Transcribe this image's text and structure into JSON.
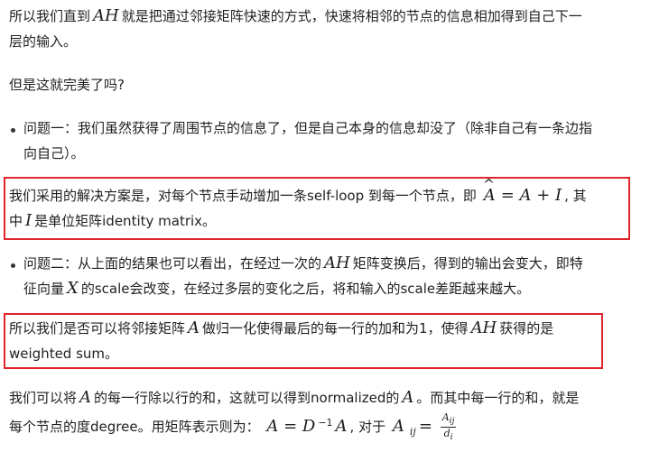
{
  "p1": {
    "part1": "所以我们直到",
    "math1": "AH",
    "part2": "就是把通过邻接矩阵快速的方式，快速将相邻的节点的信息相加得到自己下一",
    "line2": "层的输入。"
  },
  "p2": {
    "text": "但是这就完美了吗?"
  },
  "bullet1": {
    "line1": "问题一：我们虽然获得了周围节点的信息了，但是自己本身的信息却没了（除非自己有一条边指",
    "line2": "向自己）。"
  },
  "box1": {
    "part1": "我们采用的解决方案是，对每个节点手动增加一条self-loop 到每一个节点，即",
    "math_lhs": "A",
    "math_eq": "= A + I",
    "part2": ", 其",
    "line2_a": "中",
    "math_i": "I",
    "line2_b": "是单位矩阵identity matrix。"
  },
  "bullet2": {
    "part1": "问题二：从上面的结果也可以看出，在经过一次的",
    "math1": "AH",
    "part2": "矩阵变换后，得到的输出会变大，即特",
    "line2_a": "征向量",
    "math2": "X",
    "line2_b": "的scale会改变，在经过多层的变化之后，将和输入的scale差距越来越大。"
  },
  "box2": {
    "part1": "所以我们是否可以将邻接矩阵",
    "math1": "A",
    "part2": "做归一化使得最后的每一行的加和为1，使得",
    "math2": "AH",
    "part3": "获得的是",
    "line2": "weighted sum。"
  },
  "p3": {
    "part1": "我们可以将",
    "math1": "A",
    "part2": "的每一行除以行的和，这就可以得到normalized的",
    "math2": "A",
    "part3": "。而其中每一行的和，就是",
    "line2_a": "每个节点的度degree。用矩阵表示则为：",
    "eq_lhs": "A = D",
    "eq_sup": "−1",
    "eq_rhs": "A",
    "line2_b": ", 对于",
    "aij": "A",
    "aij_sub": "ij",
    "eq2": "=",
    "frac_num": "A",
    "frac_num_sub": "ij",
    "frac_den": "d",
    "frac_den_sub": "i"
  },
  "colors": {
    "highlight_border": "#e0242b",
    "text": "#1f1f1f"
  }
}
